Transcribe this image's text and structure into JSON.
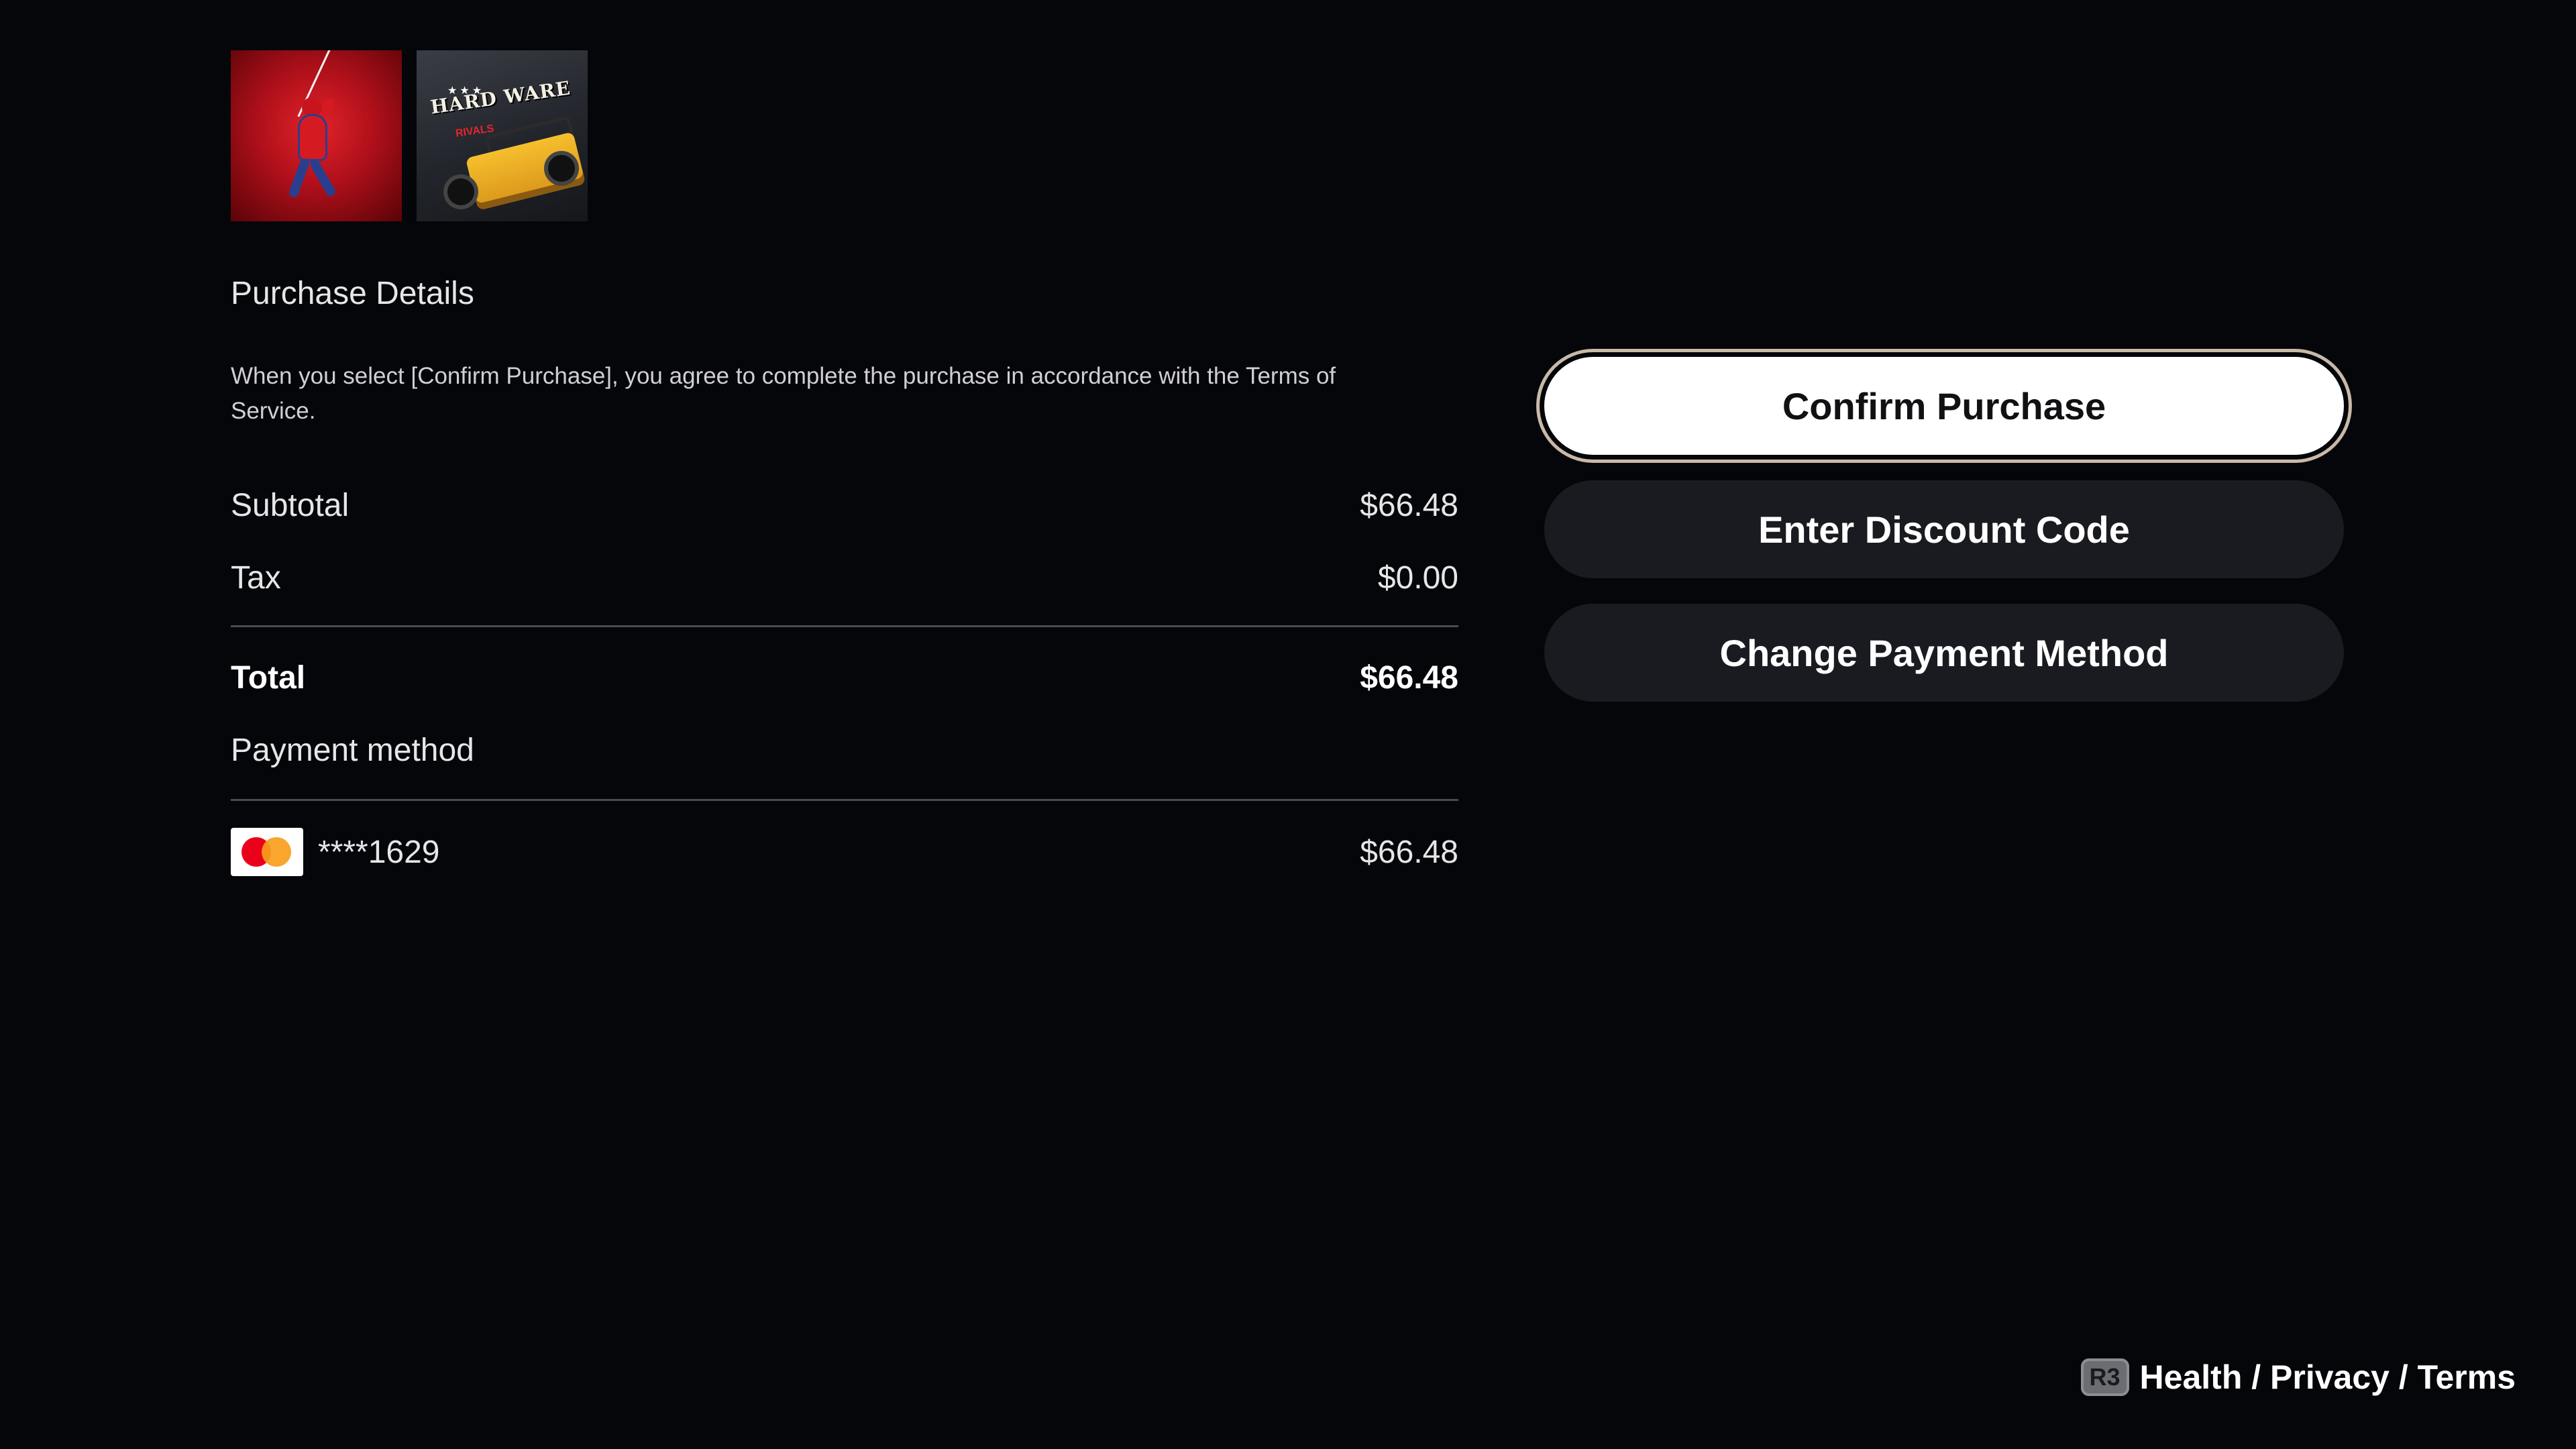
{
  "thumbnails": [
    {
      "name": "spider-man-thumbnail",
      "icon": "spider-man-art"
    },
    {
      "name": "hardware-rivals-thumbnail",
      "icon": "hardware-rivals-art",
      "logo_text": "HARD WARE",
      "logo_sub": "RIVALS",
      "stars": "★★★"
    }
  ],
  "purchase_details": {
    "title": "Purchase Details",
    "terms_text": "When you select [Confirm Purchase], you agree to complete the purchase in accordance with the Terms of Service."
  },
  "summary": {
    "subtotal_label": "Subtotal",
    "subtotal_value": "$66.48",
    "tax_label": "Tax",
    "tax_value": "$0.00",
    "total_label": "Total",
    "total_value": "$66.48"
  },
  "payment": {
    "label": "Payment method",
    "card_icon": "mastercard-icon",
    "card_masked": "****1629",
    "card_amount": "$66.48"
  },
  "actions": {
    "confirm_label": "Confirm Purchase",
    "discount_label": "Enter Discount Code",
    "change_payment_label": "Change Payment Method"
  },
  "footer": {
    "badge": "R3",
    "links_text": "Health / Privacy / Terms"
  },
  "colors": {
    "background": "#05060a",
    "button_primary_bg": "#ffffff",
    "button_secondary_bg": "#1a1b20",
    "focus_ring": "#c9b9a8",
    "mastercard_red": "#eb001b",
    "mastercard_orange": "#f79e1b"
  }
}
